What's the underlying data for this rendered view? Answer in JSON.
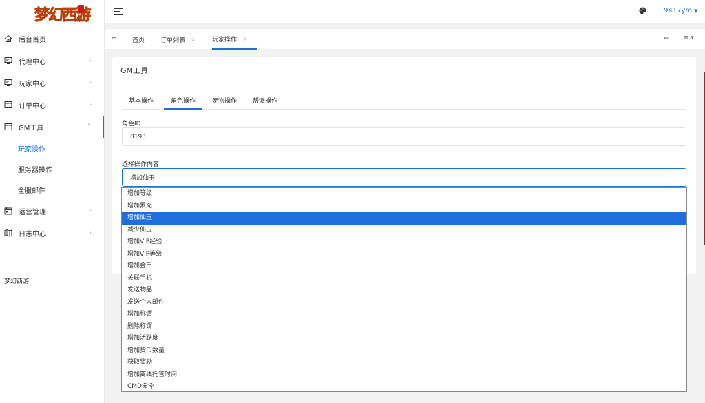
{
  "brand": {
    "logo_text": "梦幻西游",
    "footer_text": "梦幻西游"
  },
  "sidebar": {
    "items": [
      {
        "label": "后台首页",
        "icon": "home-icon",
        "has_arrow": false
      },
      {
        "label": "代理中心",
        "icon": "monitor-icon",
        "has_arrow": true
      },
      {
        "label": "玩家中心",
        "icon": "monitor-icon",
        "has_arrow": true
      },
      {
        "label": "订单中心",
        "icon": "window-icon",
        "has_arrow": true
      },
      {
        "label": "GM工具",
        "icon": "window-icon",
        "has_arrow": true,
        "open": true
      }
    ],
    "sub_items": [
      {
        "label": "玩家操作",
        "active": true
      },
      {
        "label": "服务器操作",
        "active": false
      },
      {
        "label": "全服邮件",
        "active": false
      }
    ],
    "items_after": [
      {
        "label": "运营管理",
        "icon": "calendar-icon",
        "has_arrow": true
      },
      {
        "label": "日志中心",
        "icon": "map-icon",
        "has_arrow": true
      }
    ]
  },
  "header": {
    "user": "9417ym"
  },
  "page_tabs": [
    {
      "label": "首页",
      "closable": false
    },
    {
      "label": "订单列表",
      "closable": true
    },
    {
      "label": "玩家操作",
      "closable": true,
      "active": true
    }
  ],
  "card": {
    "title": "GM工具",
    "op_tabs": [
      "基本操作",
      "角色操作",
      "宠物操作",
      "帮派操作"
    ],
    "active_op_tab": "角色操作",
    "role_id_label": "角色ID",
    "role_id_value": "8193",
    "select_label": "选择操作内容",
    "select_value": "增加仙玉"
  },
  "dropdown": {
    "options": [
      "增加等级",
      "增加累充",
      "增加仙玉",
      "减少仙玉",
      "增加VIP经验",
      "增加VIP等级",
      "增加金币",
      "关联手机",
      "发送物品",
      "发送个人邮件",
      "增加称谓",
      "删除称谓",
      "增加活跃度",
      "增加货币数量",
      "获取奖励",
      "增加离线托管时间",
      "CMD命令"
    ],
    "selected": "增加仙玉"
  },
  "colors": {
    "accent": "#1e6fd9",
    "logo_yellow": "#f7c600",
    "seal_red": "#d2181c"
  }
}
